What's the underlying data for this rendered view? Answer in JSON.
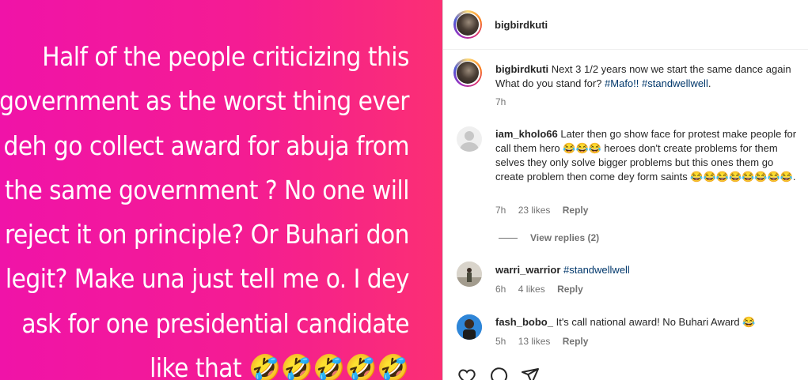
{
  "post_image": {
    "text": "Half of  the people criticizing this\ngovernment as the worst thing ever\ndeh go collect award for abuja from\nthe same government ? No one will\nreject it on principle? Or  Buhari don\nlegit? Make una just tell me o. I dey\nask for one presidential candidate\nlike that   🤣🤣🤣🤣🤣",
    "gradient_colors": [
      "#f013a8",
      "#fb2f74"
    ]
  },
  "header": {
    "username": "bigbirdkuti"
  },
  "caption": {
    "username": "bigbirdkuti",
    "text_1": "Next 3 1/2 years now we start the same dance again",
    "text_2": "What do you stand for? ",
    "hashtag_1": "#Mafo!!",
    "hashtag_2": "#standwellwell",
    "time": "7h"
  },
  "comments": [
    {
      "username": "iam_kholo66",
      "text": "Later then go show face for protest make people for call them hero 😂😂😂 heroes don't create problems for them selves they only solve bigger problems but this ones them go create problem then come dey form saints 😂😂😂😂😂😂😂😂.",
      "time": "7h",
      "likes": "23 likes",
      "reply": "Reply",
      "view_replies": "View replies (2)"
    },
    {
      "username": "warri_warrior",
      "hashtag": "#standwellwell",
      "time": "6h",
      "likes": "4 likes",
      "reply": "Reply"
    },
    {
      "username": "fash_bobo_",
      "text": "It's call national award! No Buhari Award 😂",
      "time": "5h",
      "likes": "13 likes",
      "reply": "Reply"
    }
  ],
  "actions": {
    "icons": [
      "heart-icon",
      "comment-icon",
      "share-icon"
    ]
  },
  "colors": {
    "hashtag": "#00376b",
    "meta": "#737373",
    "text": "#262626"
  }
}
